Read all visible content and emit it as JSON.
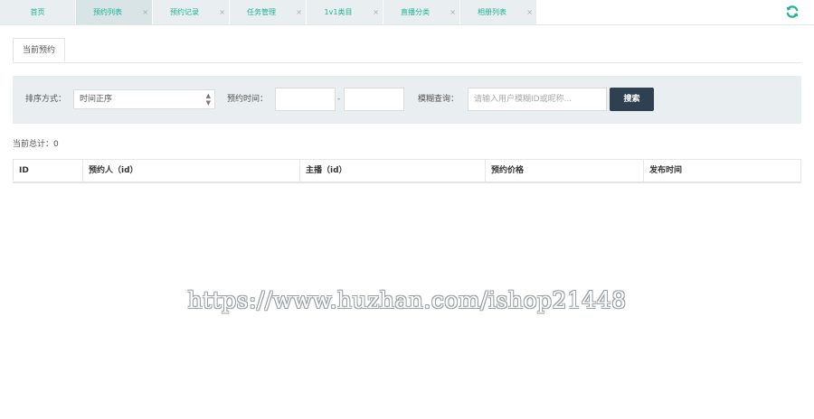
{
  "tabs": [
    {
      "label": "首页",
      "closable": false
    },
    {
      "label": "预约列表",
      "closable": true,
      "active": true
    },
    {
      "label": "预约记录",
      "closable": true
    },
    {
      "label": "任务管理",
      "closable": true
    },
    {
      "label": "1v1类目",
      "closable": true
    },
    {
      "label": "直播分类",
      "closable": true
    },
    {
      "label": "相册列表",
      "closable": true
    }
  ],
  "close_glyph": "×",
  "subtab": {
    "label": "当前预约"
  },
  "filters": {
    "sort_label": "排序方式：",
    "sort_value": "时间正序",
    "time_label": "预约时间：",
    "time_separator": "-",
    "fuzzy_label": "模糊查询：",
    "fuzzy_placeholder": "请输入用户模糊ID或昵称...",
    "search_button": "搜索"
  },
  "summary": {
    "text": "当前总计：0"
  },
  "table": {
    "headers": [
      "ID",
      "预约人（id）",
      "主播（id）",
      "预约价格",
      "发布时间"
    ],
    "rows": []
  },
  "watermark": "https://www.huzhan.com/ishop21448",
  "colors": {
    "accent": "#1ab394",
    "button_bg": "#2f4050",
    "panel_bg": "#e9eff0"
  },
  "icons": {
    "refresh": "refresh-icon",
    "select_arrow": "sort-arrows-icon"
  }
}
